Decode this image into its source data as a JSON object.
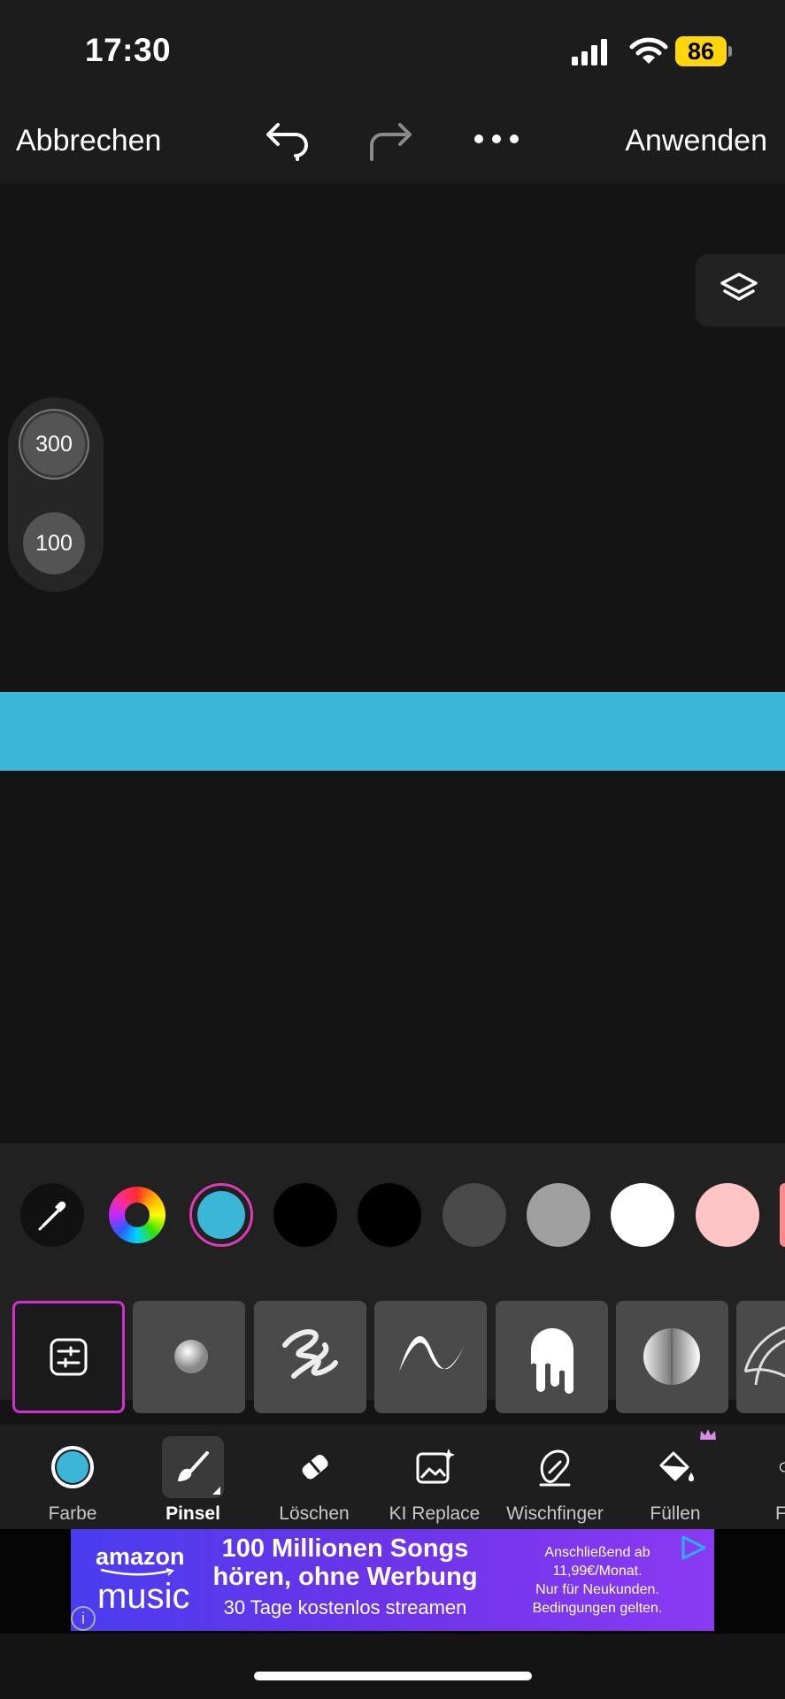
{
  "status_bar": {
    "time": "17:30",
    "battery": "86"
  },
  "top_bar": {
    "cancel_label": "Abbrechen",
    "apply_label": "Anwenden"
  },
  "size_panel": {
    "brush_size": "300",
    "opacity": "100"
  },
  "colors": {
    "selected": "#3bb6d6",
    "palette": [
      "#3bb6d6",
      "#000000",
      "#000000",
      "#4a4a4a",
      "#a0a0a0",
      "#ffffff",
      "#ffc4c4"
    ]
  },
  "tools": [
    {
      "label": "Farbe",
      "icon": "color-dot-icon"
    },
    {
      "label": "Pinsel",
      "icon": "brush-icon",
      "active": true
    },
    {
      "label": "Löschen",
      "icon": "eraser-icon"
    },
    {
      "label": "KI Replace",
      "icon": "ai-replace-icon"
    },
    {
      "label": "Wischfinger",
      "icon": "smudge-icon"
    },
    {
      "label": "Füllen",
      "icon": "fill-bucket-icon",
      "premium": true
    },
    {
      "label": "F",
      "icon": "partial-tool-icon"
    }
  ],
  "ad": {
    "brand_line1": "amazon",
    "brand_line2": "music",
    "headline_1": "100 Millionen Songs",
    "headline_2": "hören, ohne Werbung",
    "subline": "30 Tage kostenlos streamen",
    "fine_1": "Anschließend ab",
    "fine_2": "11,99€/Monat.",
    "fine_3": "Nur für Neukunden.",
    "fine_4": "Bedingungen gelten."
  }
}
